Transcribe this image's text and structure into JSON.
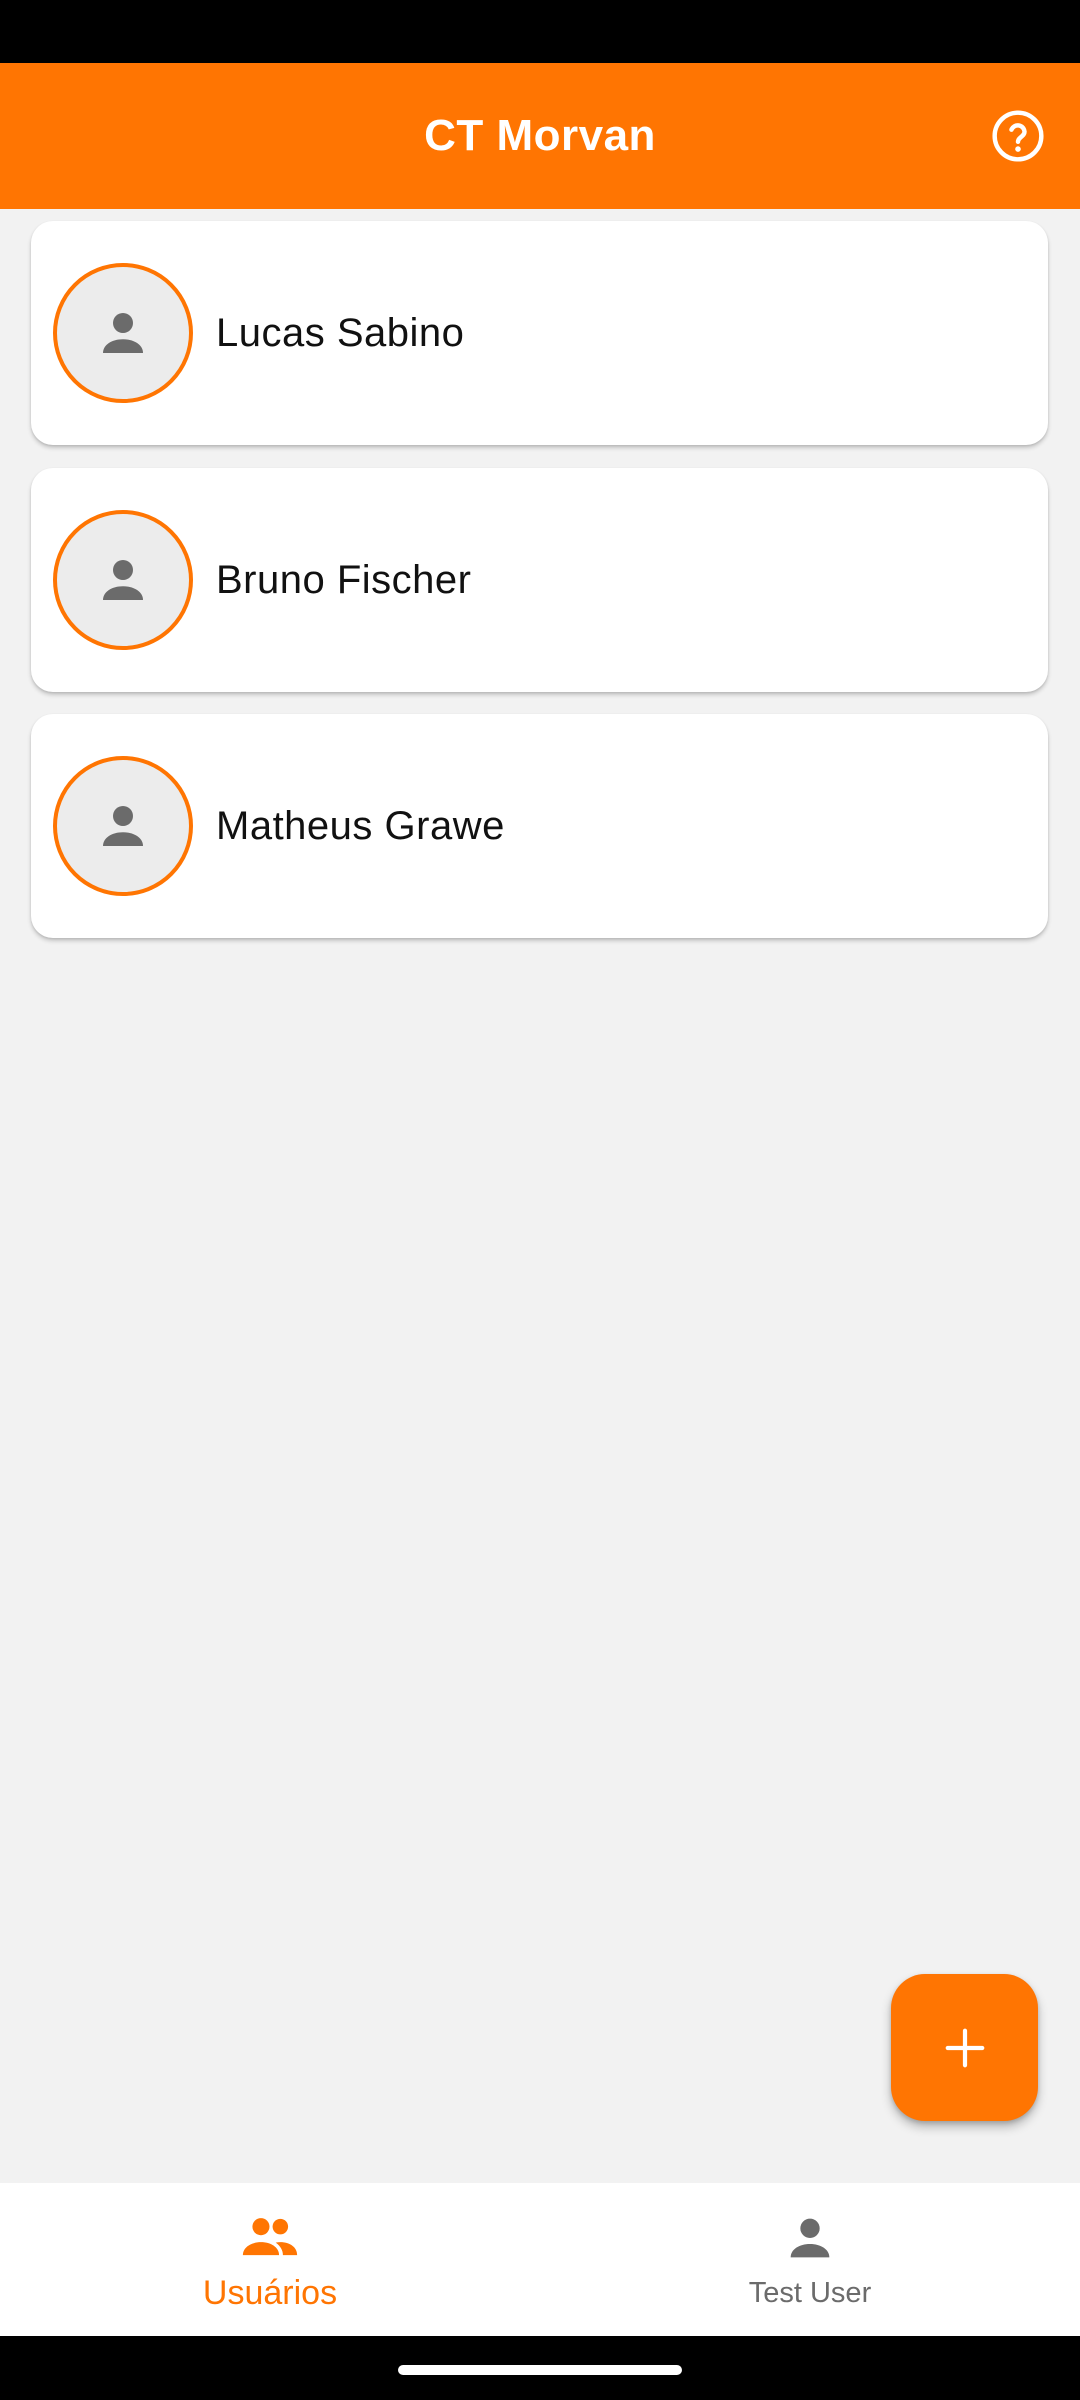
{
  "app_bar": {
    "title": "CT Morvan",
    "help_icon": "help-circle-icon"
  },
  "users": [
    {
      "name": "Lucas Sabino",
      "avatar_icon": "person-icon"
    },
    {
      "name": "Bruno Fischer",
      "avatar_icon": "person-icon"
    },
    {
      "name": "Matheus Grawe",
      "avatar_icon": "person-icon"
    }
  ],
  "fab": {
    "icon": "plus-icon"
  },
  "bottom_nav": {
    "items": [
      {
        "label": "Usuários",
        "icon": "people-icon",
        "active": true
      },
      {
        "label": "Test User",
        "icon": "person-icon",
        "active": false
      }
    ]
  },
  "colors": {
    "accent": "#ff7502",
    "background": "#f2f2f2",
    "card": "#ffffff",
    "avatar_fill": "#ececec",
    "icon_gray": "#6b6b6b",
    "inactive_label": "#6b6b6b"
  }
}
